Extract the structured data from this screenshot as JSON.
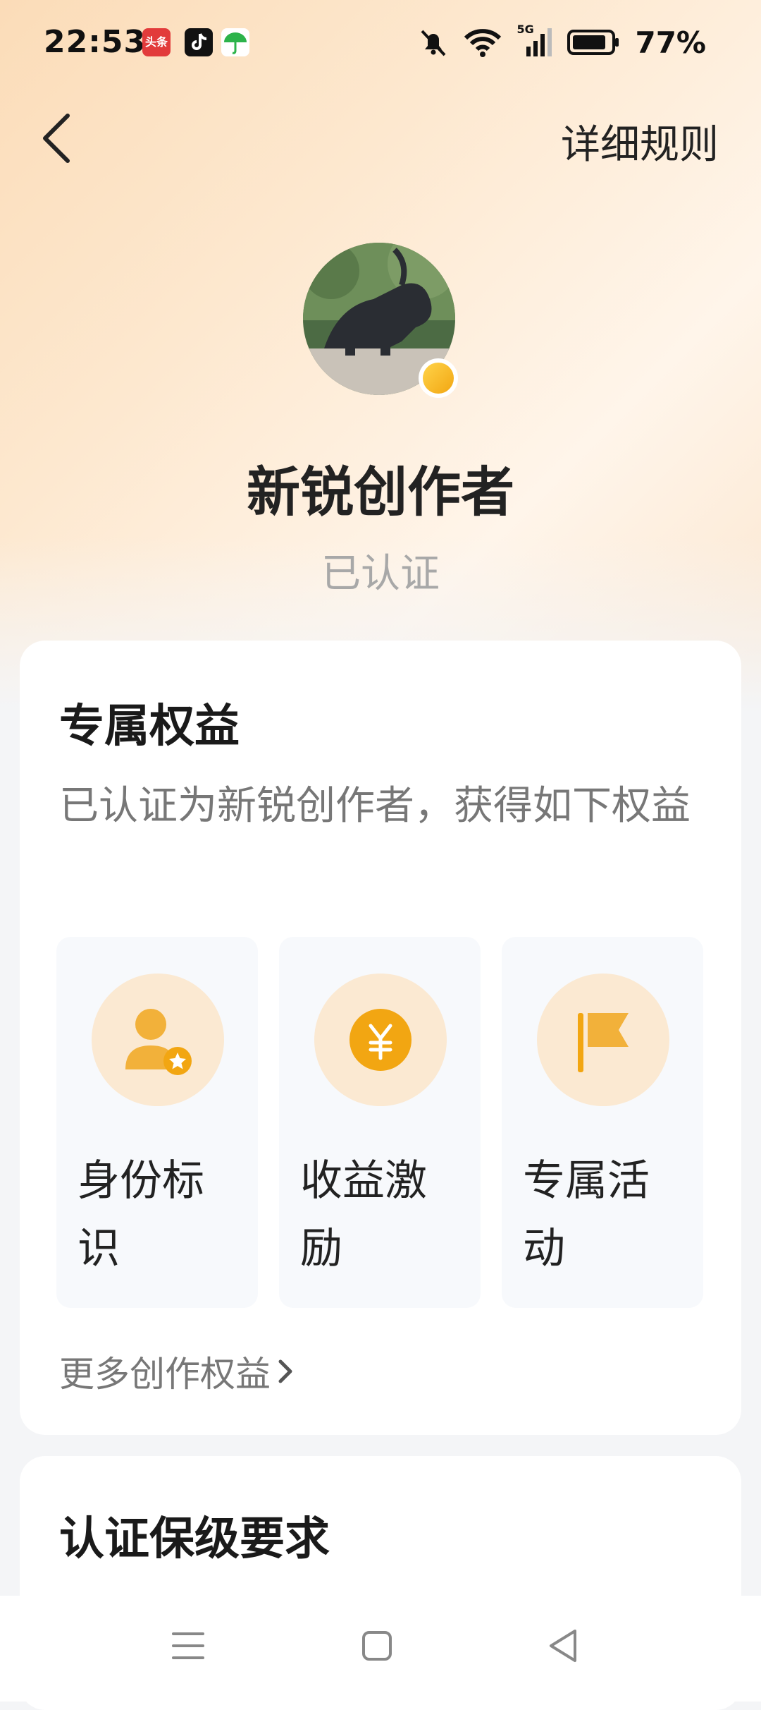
{
  "status_bar": {
    "time": "22:53",
    "battery": "77%",
    "toutiao_label": "头条",
    "network": "5G"
  },
  "nav": {
    "rules_label": "详细规则"
  },
  "profile": {
    "name": "新锐创作者",
    "status": "已认证"
  },
  "benefits_card": {
    "title": "专属权益",
    "description": "已认证为新锐创作者，获得如下权益",
    "items": [
      {
        "label": "身份标识",
        "icon": "user-star-icon"
      },
      {
        "label": "收益激励",
        "icon": "yen-coin-icon"
      },
      {
        "label": "专属活动",
        "icon": "flag-icon"
      }
    ],
    "more_link": "更多创作权益"
  },
  "requirements_card": {
    "title": "认证保级要求"
  },
  "colors": {
    "accent": "#f2a612",
    "hero_bg": "#fde8cf",
    "icon_circle": "#fbe9d2"
  }
}
